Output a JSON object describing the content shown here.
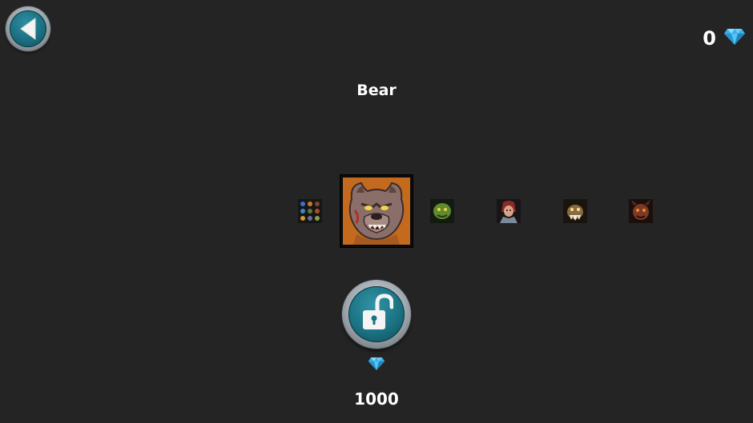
{
  "header": {
    "gem_balance": "0",
    "back_icon": "arrow-left-icon",
    "gem_icon": "diamond-icon"
  },
  "character": {
    "name": "Bear"
  },
  "carousel": {
    "items": [
      {
        "id": "random",
        "label": "random-grid-icon"
      },
      {
        "id": "bear",
        "label": "bear-portrait",
        "selected": true
      },
      {
        "id": "goblin",
        "label": "goblin-portrait"
      },
      {
        "id": "mage",
        "label": "mage-portrait"
      },
      {
        "id": "beast",
        "label": "beast-portrait"
      },
      {
        "id": "demon",
        "label": "demon-portrait"
      }
    ]
  },
  "unlock": {
    "icon": "unlocked-padlock-icon",
    "price": "1000",
    "currency_icon": "diamond-icon"
  },
  "colors": {
    "background": "#242424",
    "button_teal": "#1b7282",
    "gem_blue": "#41b8f0",
    "selected_frame": "#c46a1e"
  }
}
